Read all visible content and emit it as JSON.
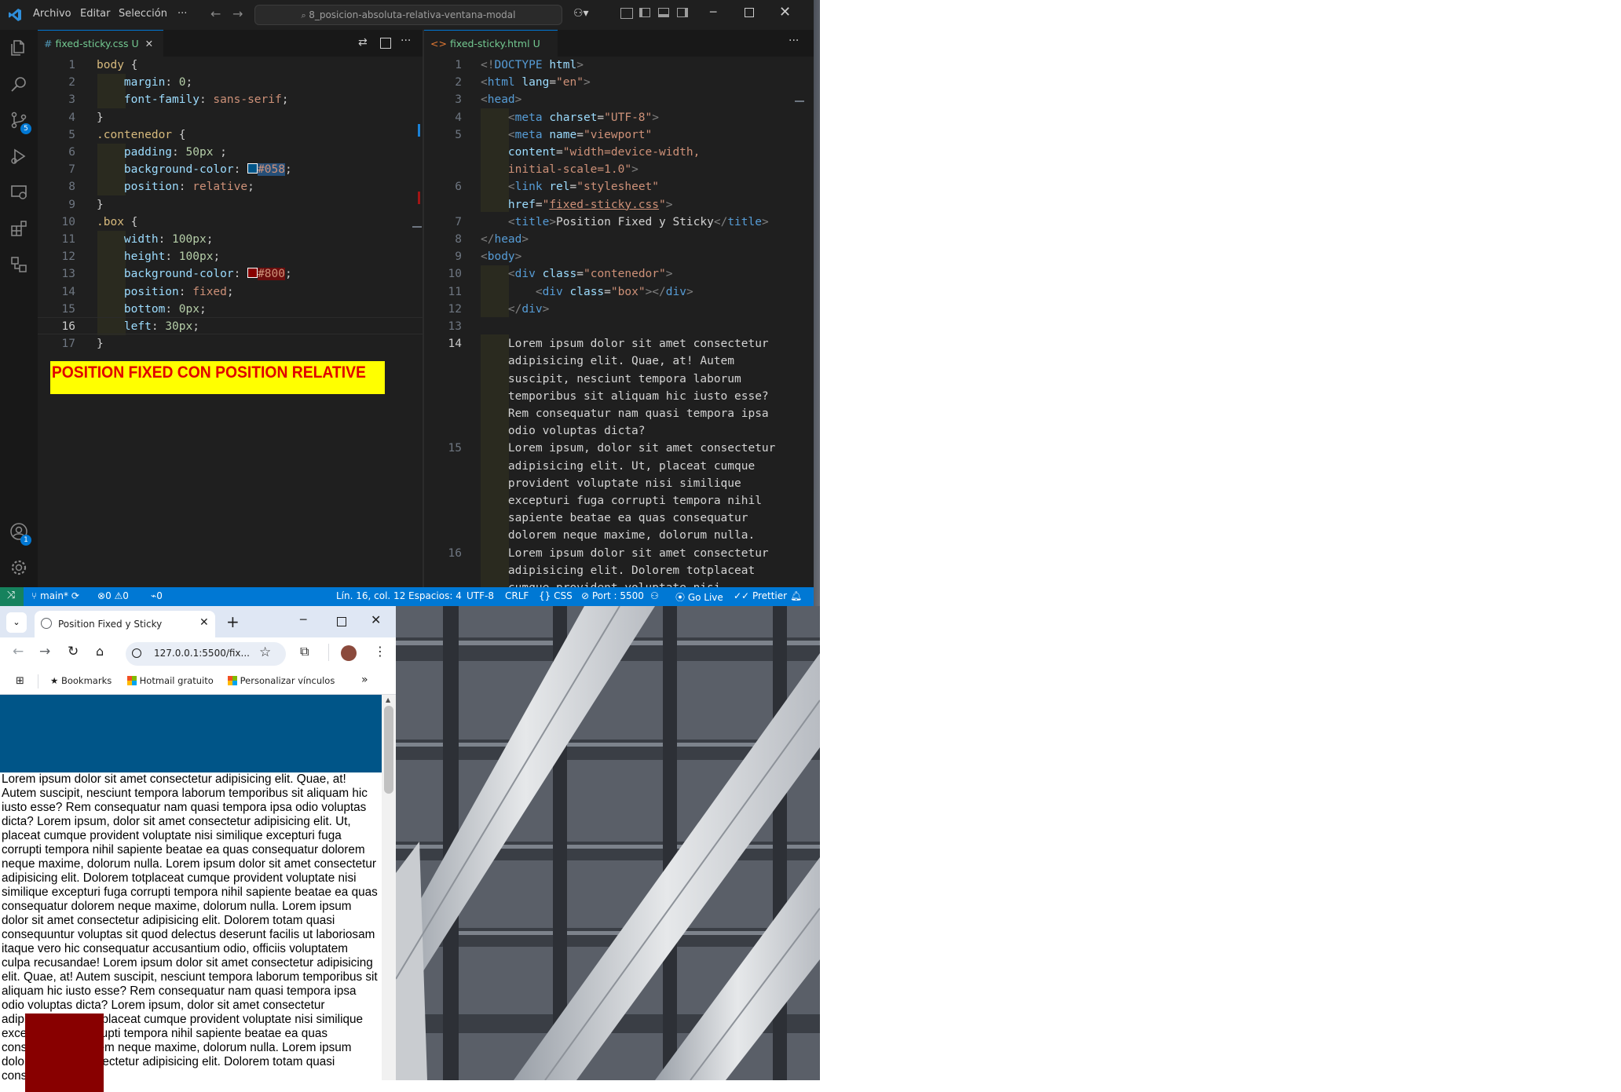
{
  "vscode": {
    "menu": [
      "Archivo",
      "Editar",
      "Selección",
      "···"
    ],
    "command_center": "8_posicion-absoluta-relativa-ventana-modal",
    "activity_badges": {
      "source_control": "5",
      "accounts": "1"
    },
    "left_tab": {
      "name": "fixed-sticky.css",
      "status": "U",
      "icon": "#"
    },
    "right_tab": {
      "name": "fixed-sticky.html",
      "status": "U",
      "icon": "<>"
    },
    "css_line_numbers": [
      "1",
      "2",
      "3",
      "4",
      "5",
      "6",
      "7",
      "8",
      "9",
      "10",
      "11",
      "12",
      "13",
      "14",
      "15",
      "16",
      "17"
    ],
    "html_line_numbers": [
      "1",
      "2",
      "3",
      "4",
      "5",
      "",
      "",
      "6",
      "",
      "7",
      "8",
      "9",
      "10",
      "11",
      "12",
      "13",
      "14",
      "",
      "",
      "",
      "",
      "",
      "15",
      "",
      "",
      "",
      "",
      "",
      "16",
      "",
      ""
    ],
    "banner": "POSITION FIXED CON POSITION RELATIVE",
    "status": {
      "branch": "main*",
      "errors": "0",
      "warnings": "0",
      "ports": "0",
      "position": "Lín. 16, col. 12",
      "spaces": "Espacios: 4",
      "encoding": "UTF-8",
      "eol": "CRLF",
      "language": "CSS",
      "port": "Port : 5500",
      "golive": "Go Live",
      "prettier": "Prettier"
    }
  },
  "chrome": {
    "tab_title": "Position Fixed y Sticky",
    "url": "127.0.0.1:5500/fix...",
    "bookmarks": [
      "Bookmarks",
      "Hotmail gratuito",
      "Personalizar vínculos"
    ],
    "body_text": "Lorem ipsum dolor sit amet consectetur adipisicing elit. Quae, at! Autem suscipit, nesciunt tempora laborum temporibus sit aliquam hic iusto esse? Rem consequatur nam quasi tempora ipsa odio voluptas dicta? Lorem ipsum, dolor sit amet consectetur adipisicing elit. Ut, placeat cumque provident voluptate nisi similique excepturi fuga corrupti tempora nihil sapiente beatae ea quas consequatur dolorem neque maxime, dolorum nulla. Lorem ipsum dolor sit amet consectetur adipisicing elit. Dolorem totplaceat cumque provident voluptate nisi similique excepturi fuga corrupti tempora nihil sapiente beatae ea quas consequatur dolorem neque maxime, dolorum nulla. Lorem ipsum dolor sit amet consectetur adipisicing elit. Dolorem totam quasi consequuntur voluptas sit quod delectus deserunt facilis ut laboriosam itaque vero hic consequatur accusantium odio, officiis voluptatem culpa recusandae! Lorem ipsum dolor sit amet consectetur adipisicing elit. Quae, at! Autem suscipit, nesciunt tempora laborum temporibus sit aliquam hic iusto esse? Rem consequatur nam quasi tempora ipsa odio voluptas dicta? Lorem ipsum, dolor sit amet consectetur adipisicing elit. Ut, placeat cumque provident voluptate nisi similique excepturi fuga corrupti tempora nihil sapiente beatae ea quas consequatur dolorem neque maxime, dolorum nulla. Lorem ipsum dolor sit amet consectetur adipisicing elit. Dolorem totam quasi consequuntur"
  },
  "colors": {
    "contenedor": "#005588",
    "box": "#880000",
    "accent": "#0078d4"
  }
}
